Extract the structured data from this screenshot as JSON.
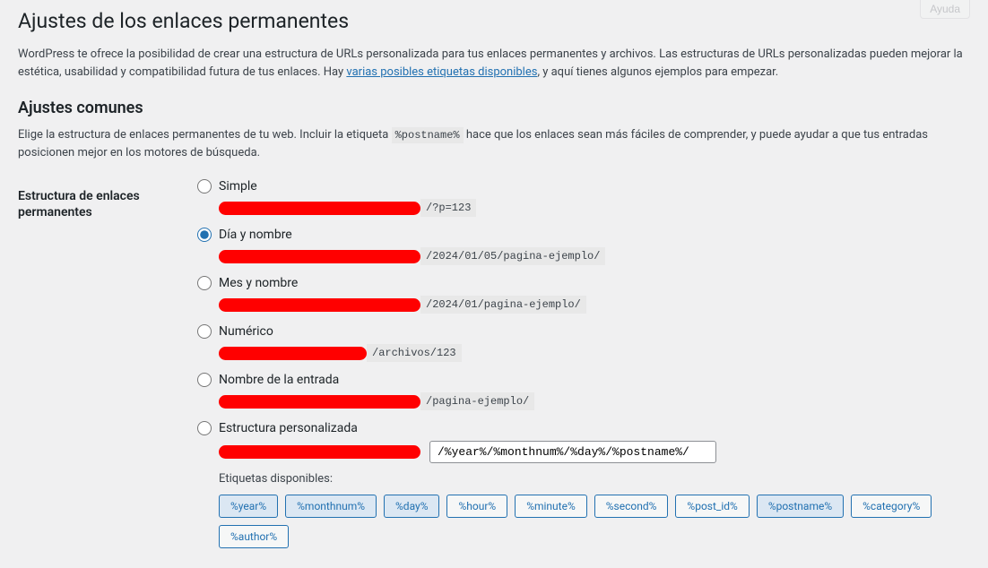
{
  "help_button": "Ayuda",
  "page_title": "Ajustes de los enlaces permanentes",
  "intro_text_before_link": "WordPress te ofrece la posibilidad de crear una estructura de URLs personalizada para tus enlaces permanentes y archivos. Las estructuras de URLs personalizadas pueden mejorar la estética, usabilidad y compatibilidad futura de tus enlaces. Hay ",
  "intro_link": "varias posibles etiquetas disponibles",
  "intro_text_after_link": ", y aquí tienes algunos ejemplos para empezar.",
  "common_settings_heading": "Ajustes comunes",
  "common_settings_desc_before": "Elige la estructura de enlaces permanentes de tu web. Incluir la etiqueta ",
  "postname_tag": "%postname%",
  "common_settings_desc_after": " hace que los enlaces sean más fáciles de comprender, y puede ayudar a que tus entradas posicionen mejor en los motores de búsqueda.",
  "structure_label": "Estructura de enlaces permanentes",
  "options": {
    "simple": {
      "label": "Simple",
      "example": "/?p=123"
    },
    "day_name": {
      "label": "Día y nombre",
      "example": "/2024/01/05/pagina-ejemplo/"
    },
    "month_name": {
      "label": "Mes y nombre",
      "example": "/2024/01/pagina-ejemplo/"
    },
    "numeric": {
      "label": "Numérico",
      "example": "/archivos/123"
    },
    "post_name": {
      "label": "Nombre de la entrada",
      "example": "/pagina-ejemplo/"
    },
    "custom": {
      "label": "Estructura personalizada",
      "value": "/%year%/%monthnum%/%day%/%postname%/"
    }
  },
  "available_tags_label": "Etiquetas disponibles:",
  "tags": {
    "year": "%year%",
    "monthnum": "%monthnum%",
    "day": "%day%",
    "hour": "%hour%",
    "minute": "%minute%",
    "second": "%second%",
    "post_id": "%post_id%",
    "postname": "%postname%",
    "category": "%category%",
    "author": "%author%"
  }
}
